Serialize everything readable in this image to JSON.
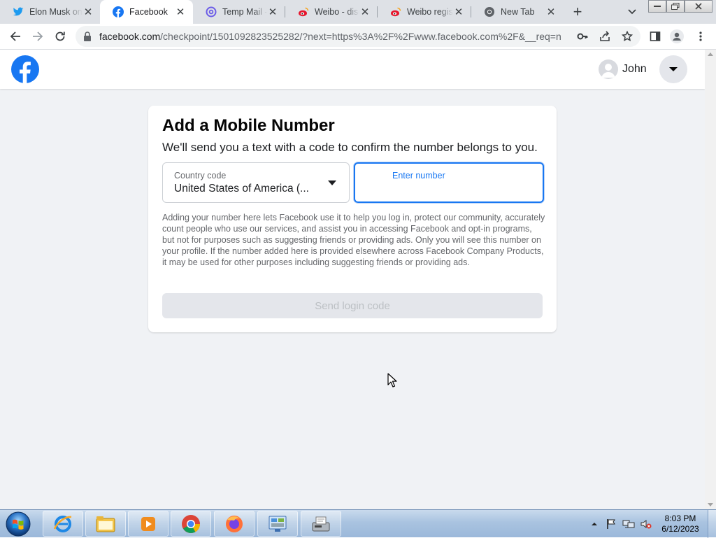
{
  "browser": {
    "tabs": [
      {
        "title": "Elon Musk on",
        "icon": "twitter-icon"
      },
      {
        "title": "Facebook",
        "icon": "facebook-icon",
        "active": true
      },
      {
        "title": "Temp Mail - D",
        "icon": "tempmail-icon"
      },
      {
        "title": "Weibo - disc",
        "icon": "weibo-icon"
      },
      {
        "title": "Weibo regist",
        "icon": "weibo-icon"
      },
      {
        "title": "New Tab",
        "icon": "chrome-icon"
      }
    ],
    "url_host": "facebook.com",
    "url_path": "/checkpoint/1501092823525282/?next=https%3A%2F%2Fwww.facebook.com%2F&__req=n"
  },
  "header": {
    "user_name": "John"
  },
  "card": {
    "title": "Add a Mobile Number",
    "subtitle": "We'll send you a text with a code to confirm the number belongs to you.",
    "country_label": "Country code",
    "country_value": "United States of America (...",
    "number_label": "Enter number",
    "number_value": "",
    "disclaimer": "Adding your number here lets Facebook use it to help you log in, protect our community, accurately count people who use our services, and assist you in accessing Facebook and opt-in programs, but not for purposes such as suggesting friends or providing ads. Only you will see this number on your profile. If the number added here is provided elsewhere across Facebook Company Products, it may be used for other purposes including suggesting friends or providing ads.",
    "send_button": "Send login code"
  },
  "taskbar": {
    "apps": [
      "internet-explorer-icon",
      "file-explorer-icon",
      "media-player-icon",
      "chrome-icon",
      "firefox-icon",
      "control-panel-icon",
      "fax-scanner-icon"
    ],
    "time": "8:03 PM",
    "date": "6/12/2023"
  },
  "colors": {
    "fb_blue": "#1877f2",
    "page_bg": "#f0f2f5",
    "weibo_red": "#e6162d",
    "twitter_blue": "#1d9bf0"
  }
}
